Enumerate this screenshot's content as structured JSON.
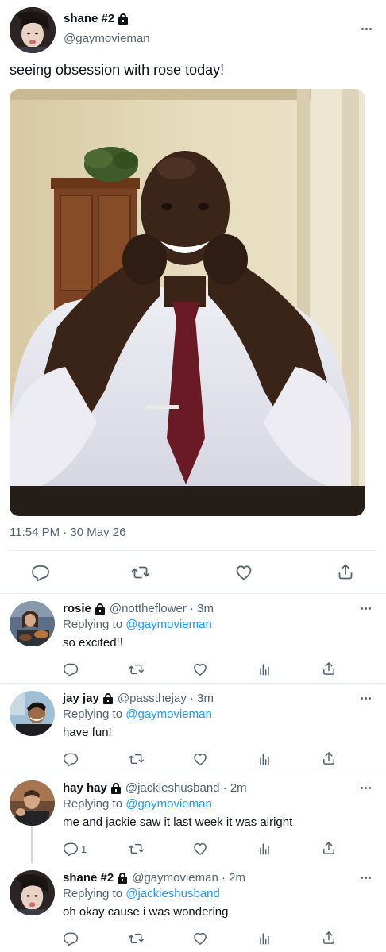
{
  "main_tweet": {
    "display_name": "shane #2",
    "handle": "@gaymovieman",
    "text": "seeing obsession with rose today!",
    "timestamp": "11:54 PM · 30 May 26",
    "icons": [
      "reply-icon",
      "retweet-icon",
      "like-icon",
      "share-icon"
    ]
  },
  "replies": [
    {
      "display_name": "rosie",
      "handle_time": "@nottheflower · 3m",
      "replying_prefix": "Replying to",
      "replying_to": "@gaymovieman",
      "text": "so excited!!",
      "reply_count": ""
    },
    {
      "display_name": "jay jay",
      "handle_time": "@passthejay · 3m",
      "replying_prefix": "Replying to",
      "replying_to": "@gaymovieman",
      "text": "have fun!",
      "reply_count": ""
    },
    {
      "display_name": "hay hay",
      "handle_time": "@jackieshusband · 2m",
      "replying_prefix": "Replying to",
      "replying_to": "@gaymovieman",
      "text": "me and jackie saw it last week it was alright",
      "reply_count": "1"
    },
    {
      "display_name": "shane #2",
      "handle_time": "@gaymovieman · 2m",
      "replying_prefix": "Replying to",
      "replying_to": "@jackieshusband",
      "text": "oh okay cause i was wondering",
      "reply_count": ""
    }
  ],
  "colors": {
    "text": "#0f1419",
    "secondary": "#536471",
    "link": "#1d9bf0",
    "divider": "#e6ecf0"
  }
}
